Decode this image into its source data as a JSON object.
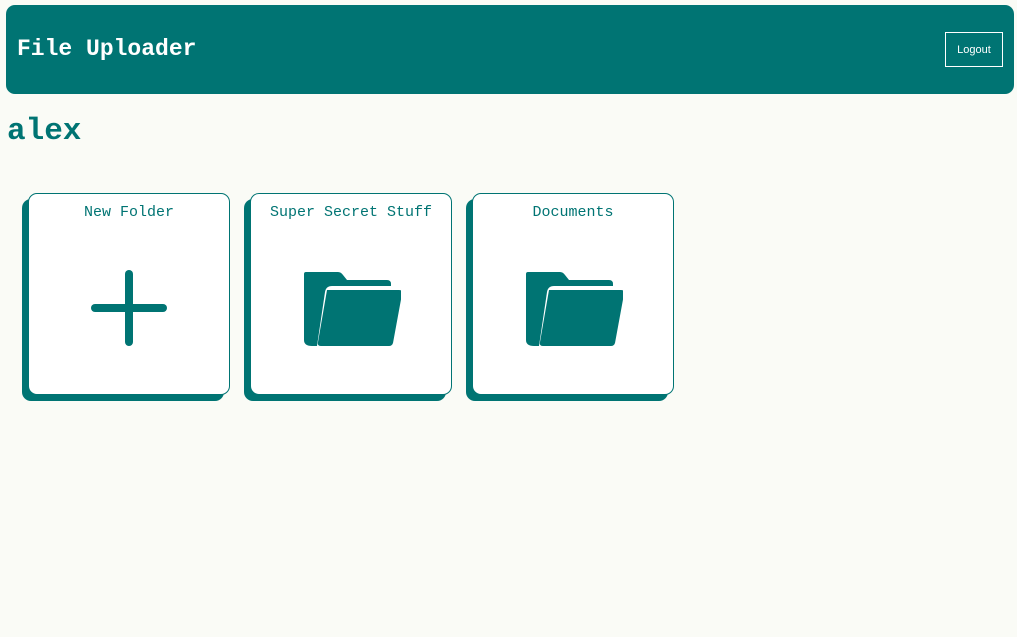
{
  "header": {
    "title": "File Uploader",
    "logout_label": "Logout"
  },
  "user": {
    "name": "alex"
  },
  "folders": [
    {
      "label": "New Folder",
      "icon": "plus-icon"
    },
    {
      "label": "Super Secret Stuff",
      "icon": "folder-open-icon"
    },
    {
      "label": "Documents",
      "icon": "folder-open-icon"
    }
  ],
  "colors": {
    "accent": "#007473",
    "background": "#fafbf6",
    "card": "#ffffff"
  }
}
